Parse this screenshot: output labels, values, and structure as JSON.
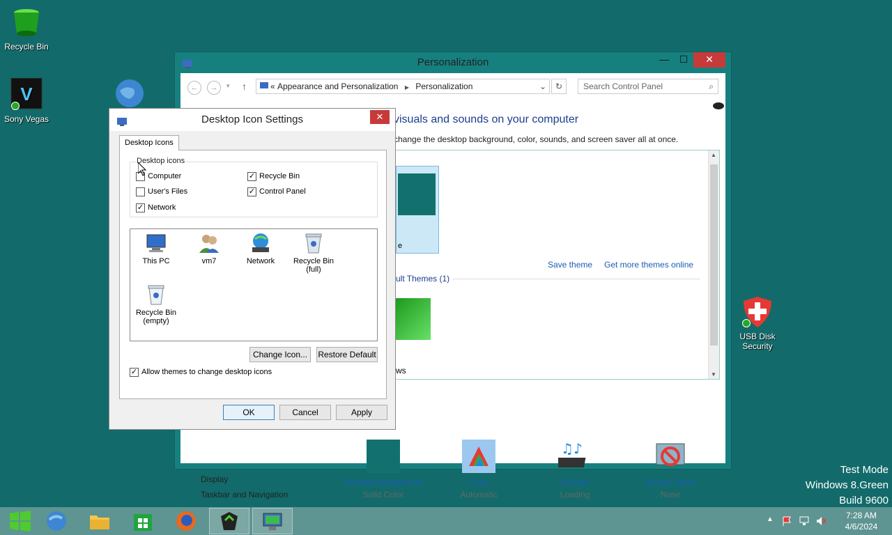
{
  "desktop": {
    "icons": [
      {
        "label": "Recycle Bin"
      },
      {
        "label": "Sony Vegas"
      },
      {
        "label": "USB Disk Security"
      }
    ],
    "watermark": [
      "Test Mode",
      "Windows 8.Green",
      "Build 9600"
    ]
  },
  "personalization": {
    "title": "Personalization",
    "breadcrumb": [
      "Appearance and Personalization",
      "Personalization"
    ],
    "breadcrumb_prefix": "«",
    "search_placeholder": "Search Control Panel",
    "heading": "visuals and sounds on your computer",
    "subheading": "change the desktop background, color, sounds, and screen saver all at once.",
    "theme_partial_label": "e",
    "save_theme": "Save theme",
    "get_more_themes": "Get more themes online",
    "default_themes": "ult Themes (1)",
    "windows_partial": "ws",
    "sidebar_bottom": [
      "Display",
      "Taskbar and Navigation"
    ],
    "bottom_items": [
      {
        "label": "Desktop Background",
        "sub": "Solid Color"
      },
      {
        "label": "Color",
        "sub": "Automatic"
      },
      {
        "label": "Sounds",
        "sub": "Loading"
      },
      {
        "label": "Screen Saver",
        "sub": "None"
      }
    ]
  },
  "dialog": {
    "title": "Desktop Icon Settings",
    "tab": "Desktop Icons",
    "group_label": "Desktop icons",
    "checkboxes": [
      {
        "label": "Computer",
        "checked": false
      },
      {
        "label": "Recycle Bin",
        "checked": true
      },
      {
        "label": "User's Files",
        "checked": false
      },
      {
        "label": "Control Panel",
        "checked": true
      },
      {
        "label": "Network",
        "checked": true
      }
    ],
    "icons": [
      {
        "label": "This PC"
      },
      {
        "label": "vm7"
      },
      {
        "label": "Network"
      },
      {
        "label": "Recycle Bin (full)"
      },
      {
        "label": "Recycle Bin (empty)"
      }
    ],
    "change_icon": "Change Icon...",
    "restore_default": "Restore Default",
    "allow_themes": "Allow themes to change desktop icons",
    "allow_themes_checked": true,
    "ok": "OK",
    "cancel": "Cancel",
    "apply": "Apply"
  },
  "taskbar": {
    "time": "7:28 AM",
    "date": "4/6/2024"
  }
}
